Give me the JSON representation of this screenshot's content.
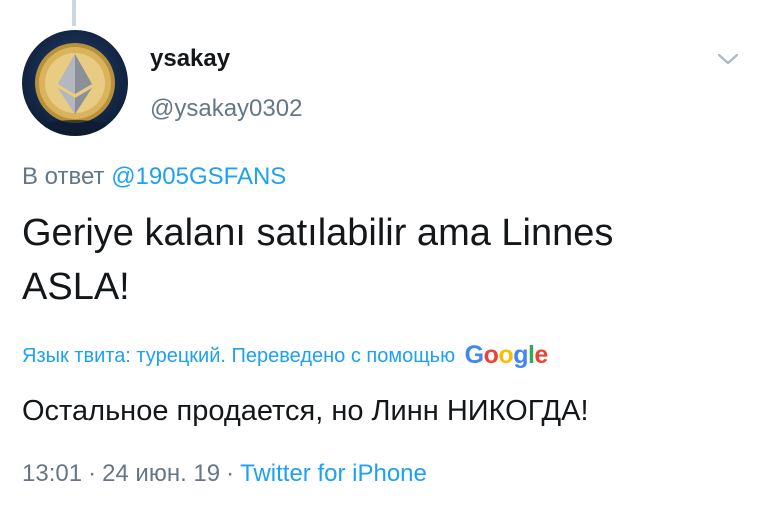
{
  "tweet": {
    "user": {
      "display_name": "ysakay",
      "handle": "@ysakay0302",
      "avatar_icon": "ethereum-coin-avatar"
    },
    "menu_icon": "chevron-down-icon",
    "reply": {
      "prefix": "В ответ",
      "to_handle": "@1905GSFANS"
    },
    "text": "Geriye kalanı satılabilir ama Linnes ASLA!",
    "translation": {
      "label": "Язык твита: турецкий. Переведено с помощью",
      "provider_letters": [
        "G",
        "o",
        "o",
        "g",
        "l",
        "e"
      ],
      "provider_colors": [
        "#4285f4",
        "#ea4335",
        "#fbbc05",
        "#4285f4",
        "#34a853",
        "#ea4335"
      ],
      "text": "Остальное продается, но Линн НИКОГДА!"
    },
    "meta": {
      "time": "13:01",
      "separator": "·",
      "date": "24 июн. 19",
      "source": "Twitter for iPhone"
    }
  },
  "colors": {
    "link": "#1da1f2",
    "secondary_text": "#657786",
    "primary_text": "#14171a"
  }
}
